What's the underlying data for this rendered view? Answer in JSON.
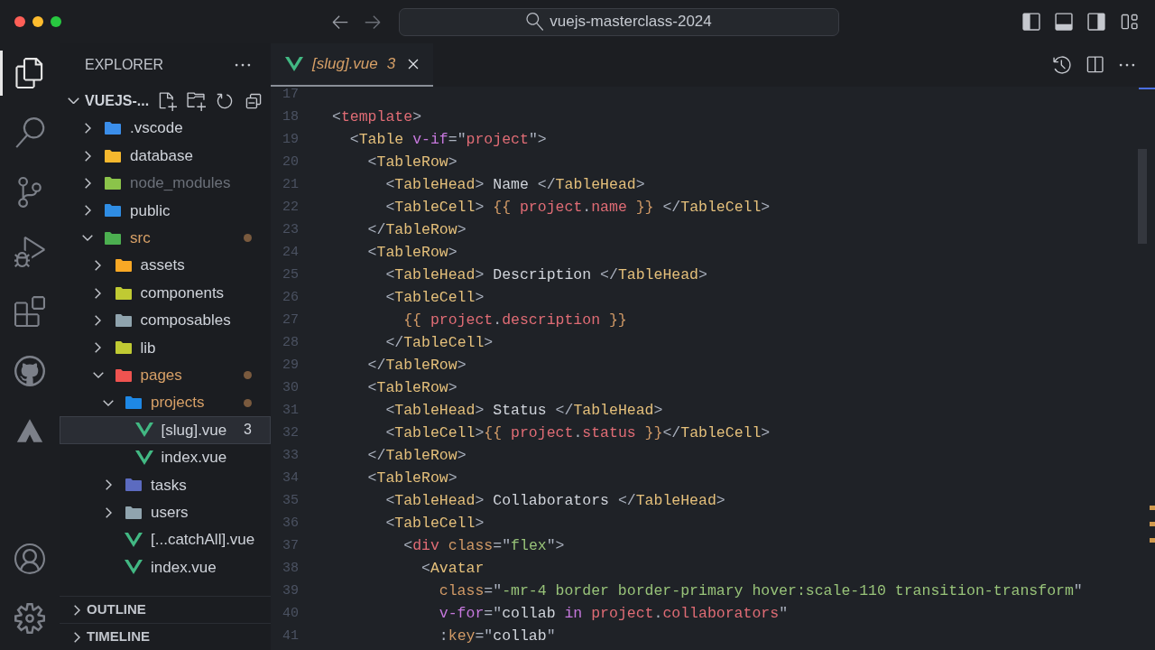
{
  "title_bar": {
    "search": "vuejs-masterclass-2024"
  },
  "activity_bar": [
    {
      "kind": "explorer",
      "selected": true
    },
    {
      "kind": "search",
      "selected": false
    },
    {
      "kind": "source-control",
      "selected": false
    },
    {
      "kind": "run",
      "selected": false
    },
    {
      "kind": "extensions",
      "selected": false
    },
    {
      "kind": "github",
      "selected": false
    },
    {
      "kind": "triangle",
      "selected": false
    },
    {
      "kind": "account",
      "selected": false
    },
    {
      "kind": "settings",
      "selected": false
    }
  ],
  "explorer": {
    "title": "EXPLORER",
    "root": {
      "label": "VUEJS-...",
      "expanded": true
    },
    "tree": [
      {
        "label": ".vscode",
        "kind": "folder",
        "color": "#3b8eea",
        "expanded": false
      },
      {
        "label": "database",
        "kind": "folder",
        "color": "#f5b82e",
        "expanded": false
      },
      {
        "label": "node_modules",
        "kind": "folder",
        "color": "#8bc34a",
        "expanded": false,
        "ignored": true
      },
      {
        "label": "public",
        "kind": "folder",
        "color": "#2f8de4",
        "expanded": false
      },
      {
        "label": "src",
        "kind": "folder",
        "color": "#4caf50",
        "expanded": true,
        "modified": true,
        "children": [
          {
            "label": "assets",
            "kind": "folder",
            "color": "#f9a825",
            "expanded": false
          },
          {
            "label": "components",
            "kind": "folder",
            "color": "#c0ca33",
            "expanded": false
          },
          {
            "label": "composables",
            "kind": "folder",
            "color": "#90a4ae",
            "expanded": false
          },
          {
            "label": "lib",
            "kind": "folder",
            "color": "#c0ca33",
            "expanded": false
          },
          {
            "label": "pages",
            "kind": "folder",
            "color": "#ef5350",
            "expanded": true,
            "modified": true,
            "children": [
              {
                "label": "projects",
                "kind": "folder",
                "color": "#1e88e5",
                "expanded": true,
                "modified": true,
                "children": [
                  {
                    "label": "[slug].vue",
                    "kind": "vue-file",
                    "selected": true,
                    "badge": "3"
                  },
                  {
                    "label": "index.vue",
                    "kind": "vue-file",
                    "selected": false
                  }
                ]
              },
              {
                "label": "tasks",
                "kind": "folder",
                "color": "#5c6bc0",
                "expanded": false
              },
              {
                "label": "users",
                "kind": "folder",
                "color": "#90a4ae",
                "expanded": false
              },
              {
                "label": "[...catchAll].vue",
                "kind": "vue-file",
                "selected": false
              },
              {
                "label": "index.vue",
                "kind": "vue-file",
                "selected": false
              }
            ]
          }
        ]
      }
    ],
    "sections": [
      {
        "label": "OUTLINE",
        "expanded": false
      },
      {
        "label": "TIMELINE",
        "expanded": false
      }
    ]
  },
  "tabs": [
    {
      "label": "[slug].vue",
      "badge": "3",
      "selected": true,
      "preview": true
    }
  ],
  "editor": {
    "lines": [
      {
        "number": "17"
      },
      {
        "number": "18",
        "tokens": [
          {
            "kind": "punct",
            "text": "<"
          },
          {
            "kind": "html",
            "text": "template"
          },
          {
            "kind": "punct",
            "text": ">"
          }
        ]
      },
      {
        "number": "19",
        "tokens": [
          {
            "kind": "punct",
            "text": "  <"
          },
          {
            "kind": "component",
            "text": "Table"
          },
          {
            "kind": "directive",
            "text": " v-if"
          },
          {
            "kind": "punct",
            "text": "=\""
          },
          {
            "kind": "ident",
            "text": "project"
          },
          {
            "kind": "punct",
            "text": "\">"
          }
        ]
      },
      {
        "number": "20",
        "tokens": [
          {
            "kind": "punct",
            "text": "    <"
          },
          {
            "kind": "component",
            "text": "TableRow"
          },
          {
            "kind": "punct",
            "text": ">"
          }
        ]
      },
      {
        "number": "21",
        "tokens": [
          {
            "kind": "punct",
            "text": "      <"
          },
          {
            "kind": "component",
            "text": "TableHead"
          },
          {
            "kind": "punct",
            "text": ">"
          },
          {
            "kind": "text",
            "text": " Name "
          },
          {
            "kind": "punct",
            "text": "</"
          },
          {
            "kind": "component",
            "text": "TableHead"
          },
          {
            "kind": "punct",
            "text": ">"
          }
        ]
      },
      {
        "number": "22",
        "tokens": [
          {
            "kind": "punct",
            "text": "      <"
          },
          {
            "kind": "component",
            "text": "TableCell"
          },
          {
            "kind": "punct",
            "text": "> "
          },
          {
            "kind": "brace",
            "text": "{{ "
          },
          {
            "kind": "ident",
            "text": "project"
          },
          {
            "kind": "punct",
            "text": "."
          },
          {
            "kind": "ident",
            "text": "name"
          },
          {
            "kind": "brace",
            "text": " }}"
          },
          {
            "kind": "punct",
            "text": " </"
          },
          {
            "kind": "component",
            "text": "TableCell"
          },
          {
            "kind": "punct",
            "text": ">"
          }
        ]
      },
      {
        "number": "23",
        "tokens": [
          {
            "kind": "punct",
            "text": "    </"
          },
          {
            "kind": "component",
            "text": "TableRow"
          },
          {
            "kind": "punct",
            "text": ">"
          }
        ]
      },
      {
        "number": "24",
        "tokens": [
          {
            "kind": "punct",
            "text": "    <"
          },
          {
            "kind": "component",
            "text": "TableRow"
          },
          {
            "kind": "punct",
            "text": ">"
          }
        ]
      },
      {
        "number": "25",
        "tokens": [
          {
            "kind": "punct",
            "text": "      <"
          },
          {
            "kind": "component",
            "text": "TableHead"
          },
          {
            "kind": "punct",
            "text": ">"
          },
          {
            "kind": "text",
            "text": " Description "
          },
          {
            "kind": "punct",
            "text": "</"
          },
          {
            "kind": "component",
            "text": "TableHead"
          },
          {
            "kind": "punct",
            "text": ">"
          }
        ]
      },
      {
        "number": "26",
        "tokens": [
          {
            "kind": "punct",
            "text": "      <"
          },
          {
            "kind": "component",
            "text": "TableCell"
          },
          {
            "kind": "punct",
            "text": ">"
          }
        ]
      },
      {
        "number": "27",
        "tokens": [
          {
            "kind": "brace",
            "text": "        {{ "
          },
          {
            "kind": "ident",
            "text": "project"
          },
          {
            "kind": "punct",
            "text": "."
          },
          {
            "kind": "ident",
            "text": "description"
          },
          {
            "kind": "brace",
            "text": " }}"
          }
        ]
      },
      {
        "number": "28",
        "tokens": [
          {
            "kind": "punct",
            "text": "      </"
          },
          {
            "kind": "component",
            "text": "TableCell"
          },
          {
            "kind": "punct",
            "text": ">"
          }
        ]
      },
      {
        "number": "29",
        "tokens": [
          {
            "kind": "punct",
            "text": "    </"
          },
          {
            "kind": "component",
            "text": "TableRow"
          },
          {
            "kind": "punct",
            "text": ">"
          }
        ]
      },
      {
        "number": "30",
        "tokens": [
          {
            "kind": "punct",
            "text": "    <"
          },
          {
            "kind": "component",
            "text": "TableRow"
          },
          {
            "kind": "punct",
            "text": ">"
          }
        ]
      },
      {
        "number": "31",
        "tokens": [
          {
            "kind": "punct",
            "text": "      <"
          },
          {
            "kind": "component",
            "text": "TableHead"
          },
          {
            "kind": "punct",
            "text": ">"
          },
          {
            "kind": "text",
            "text": " Status "
          },
          {
            "kind": "punct",
            "text": "</"
          },
          {
            "kind": "component",
            "text": "TableHead"
          },
          {
            "kind": "punct",
            "text": ">"
          }
        ]
      },
      {
        "number": "32",
        "tokens": [
          {
            "kind": "punct",
            "text": "      <"
          },
          {
            "kind": "component",
            "text": "TableCell"
          },
          {
            "kind": "punct",
            "text": ">"
          },
          {
            "kind": "brace",
            "text": "{{ "
          },
          {
            "kind": "ident",
            "text": "project"
          },
          {
            "kind": "punct",
            "text": "."
          },
          {
            "kind": "ident",
            "text": "status"
          },
          {
            "kind": "brace",
            "text": " }}"
          },
          {
            "kind": "punct",
            "text": "</"
          },
          {
            "kind": "component",
            "text": "TableCell"
          },
          {
            "kind": "punct",
            "text": ">"
          }
        ]
      },
      {
        "number": "33",
        "tokens": [
          {
            "kind": "punct",
            "text": "    </"
          },
          {
            "kind": "component",
            "text": "TableRow"
          },
          {
            "kind": "punct",
            "text": ">"
          }
        ]
      },
      {
        "number": "34",
        "tokens": [
          {
            "kind": "punct",
            "text": "    <"
          },
          {
            "kind": "component",
            "text": "TableRow"
          },
          {
            "kind": "punct",
            "text": ">"
          }
        ]
      },
      {
        "number": "35",
        "tokens": [
          {
            "kind": "punct",
            "text": "      <"
          },
          {
            "kind": "component",
            "text": "TableHead"
          },
          {
            "kind": "punct",
            "text": ">"
          },
          {
            "kind": "text",
            "text": " Collaborators "
          },
          {
            "kind": "punct",
            "text": "</"
          },
          {
            "kind": "component",
            "text": "TableHead"
          },
          {
            "kind": "punct",
            "text": ">"
          }
        ]
      },
      {
        "number": "36",
        "tokens": [
          {
            "kind": "punct",
            "text": "      <"
          },
          {
            "kind": "component",
            "text": "TableCell"
          },
          {
            "kind": "punct",
            "text": ">"
          }
        ]
      },
      {
        "number": "37",
        "tokens": [
          {
            "kind": "punct",
            "text": "        <"
          },
          {
            "kind": "html",
            "text": "div"
          },
          {
            "kind": "attr",
            "text": " class"
          },
          {
            "kind": "punct",
            "text": "=\""
          },
          {
            "kind": "string",
            "text": "flex"
          },
          {
            "kind": "punct",
            "text": "\">"
          }
        ]
      },
      {
        "number": "38",
        "tokens": [
          {
            "kind": "punct",
            "text": "          <"
          },
          {
            "kind": "component",
            "text": "Avatar"
          }
        ]
      },
      {
        "number": "39",
        "tokens": [
          {
            "kind": "attr",
            "text": "            class"
          },
          {
            "kind": "punct",
            "text": "=\""
          },
          {
            "kind": "string",
            "text": "-mr-4 border border-primary hover:scale-110 transition-transform"
          },
          {
            "kind": "punct",
            "text": "\""
          }
        ]
      },
      {
        "number": "40",
        "tokens": [
          {
            "kind": "directive",
            "text": "            v-for"
          },
          {
            "kind": "punct",
            "text": "=\""
          },
          {
            "kind": "text",
            "text": "collab"
          },
          {
            "kind": "directive",
            "text": " in "
          },
          {
            "kind": "ident",
            "text": "project"
          },
          {
            "kind": "punct",
            "text": "."
          },
          {
            "kind": "ident",
            "text": "collaborators"
          },
          {
            "kind": "punct",
            "text": "\""
          }
        ]
      },
      {
        "number": "41",
        "tokens": [
          {
            "kind": "punct",
            "text": "            :"
          },
          {
            "kind": "attr",
            "text": "key"
          },
          {
            "kind": "punct",
            "text": "=\""
          },
          {
            "kind": "text",
            "text": "collab"
          },
          {
            "kind": "punct",
            "text": "\""
          }
        ]
      }
    ]
  }
}
